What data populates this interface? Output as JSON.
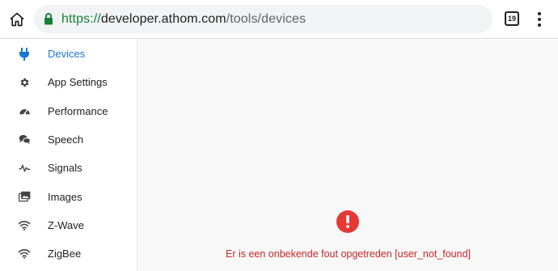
{
  "browser": {
    "url_scheme": "https://",
    "url_host": "developer.athom.com",
    "url_path": "/tools/devices",
    "tab_count": "19"
  },
  "sidebar": {
    "items": [
      {
        "label": "Devices",
        "icon": "plug-icon",
        "active": true
      },
      {
        "label": "App Settings",
        "icon": "gear-icon",
        "active": false
      },
      {
        "label": "Performance",
        "icon": "speedometer-icon",
        "active": false
      },
      {
        "label": "Speech",
        "icon": "chat-bubbles-icon",
        "active": false
      },
      {
        "label": "Signals",
        "icon": "waveform-icon",
        "active": false
      },
      {
        "label": "Images",
        "icon": "images-icon",
        "active": false
      },
      {
        "label": "Z-Wave",
        "icon": "wifi-icon",
        "active": false
      },
      {
        "label": "ZigBee",
        "icon": "wifi-icon",
        "active": false
      }
    ]
  },
  "main": {
    "error_text": "Er is een onbekende fout opgetreden [user_not_found]"
  },
  "colors": {
    "accent": "#1976d2",
    "error": "#e53935",
    "secure": "#188038"
  }
}
